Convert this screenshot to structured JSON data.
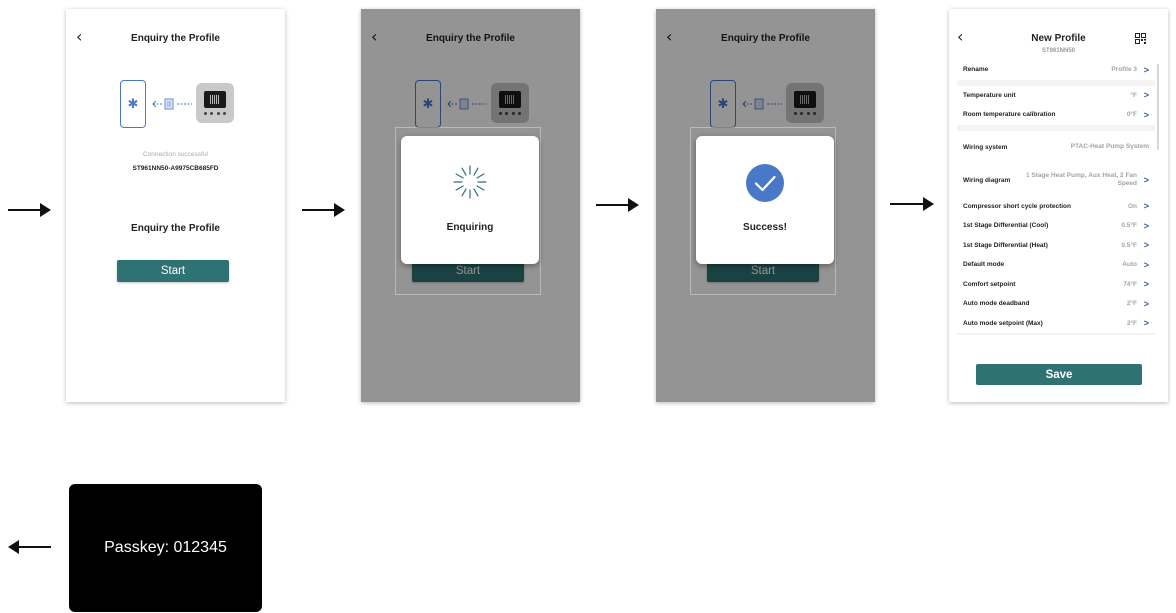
{
  "screen1": {
    "title": "Enquiry the Profile",
    "back_glyph": "‹",
    "connection_status": "Connection successful",
    "device_serial": "ST961NN50-A9975CB685FD",
    "section_title": "Enquiry the Profile",
    "start_label": "Start"
  },
  "screen2": {
    "title": "Enquiry the Profile",
    "back_glyph": "‹",
    "modal_label": "Enquiring",
    "start_label": "Start"
  },
  "screen3": {
    "title": "Enquiry the Profile",
    "back_glyph": "‹",
    "modal_label": "Success!",
    "start_label": "Start"
  },
  "screen4": {
    "back_glyph": "‹",
    "title": "New Profile",
    "subtitle": "ST961NN50",
    "groups": [
      {
        "rows": [
          {
            "label": "Rename",
            "value": "Profile 3"
          }
        ]
      },
      {
        "rows": [
          {
            "label": "Temperature unit",
            "value": "°F"
          },
          {
            "label": "Room temperature calibration",
            "value": "0°F"
          }
        ]
      },
      {
        "rows": [
          {
            "label": "Wiring system",
            "value": "PTAC-Heat Pump System"
          },
          {
            "label": "Wiring diagram",
            "value": "1 Stage Heat Pump, Aux Heat, 2 Fan Speed"
          },
          {
            "label": "Compressor short cycle protection",
            "value": "On"
          },
          {
            "label": "1st Stage Differential (Cool)",
            "value": "0.5°F"
          },
          {
            "label": "1st Stage Differential (Heat)",
            "value": "0.5°F"
          },
          {
            "label": "Default mode",
            "value": "Auto"
          },
          {
            "label": "Comfort setpoint",
            "value": "74°F"
          },
          {
            "label": "Auto mode deadband",
            "value": "2°F"
          },
          {
            "label": "Auto mode setpoint (Max)",
            "value": "2°F"
          }
        ]
      }
    ],
    "chevron_glyph": ">",
    "save_label": "Save"
  },
  "passkey": {
    "text": "Passkey: 012345"
  },
  "colors": {
    "primary_teal": "#2f7274",
    "accent_blue": "#4a78c8",
    "chevron_blue": "#2e5fa8"
  },
  "icons": [
    "arrow-right-icon",
    "arrow-left-icon",
    "back-chevron-icon",
    "bluetooth-icon",
    "document-icon",
    "thermostat-device-icon",
    "loading-spinner-icon",
    "success-check-icon",
    "qr-code-icon",
    "chevron-right-icon"
  ]
}
